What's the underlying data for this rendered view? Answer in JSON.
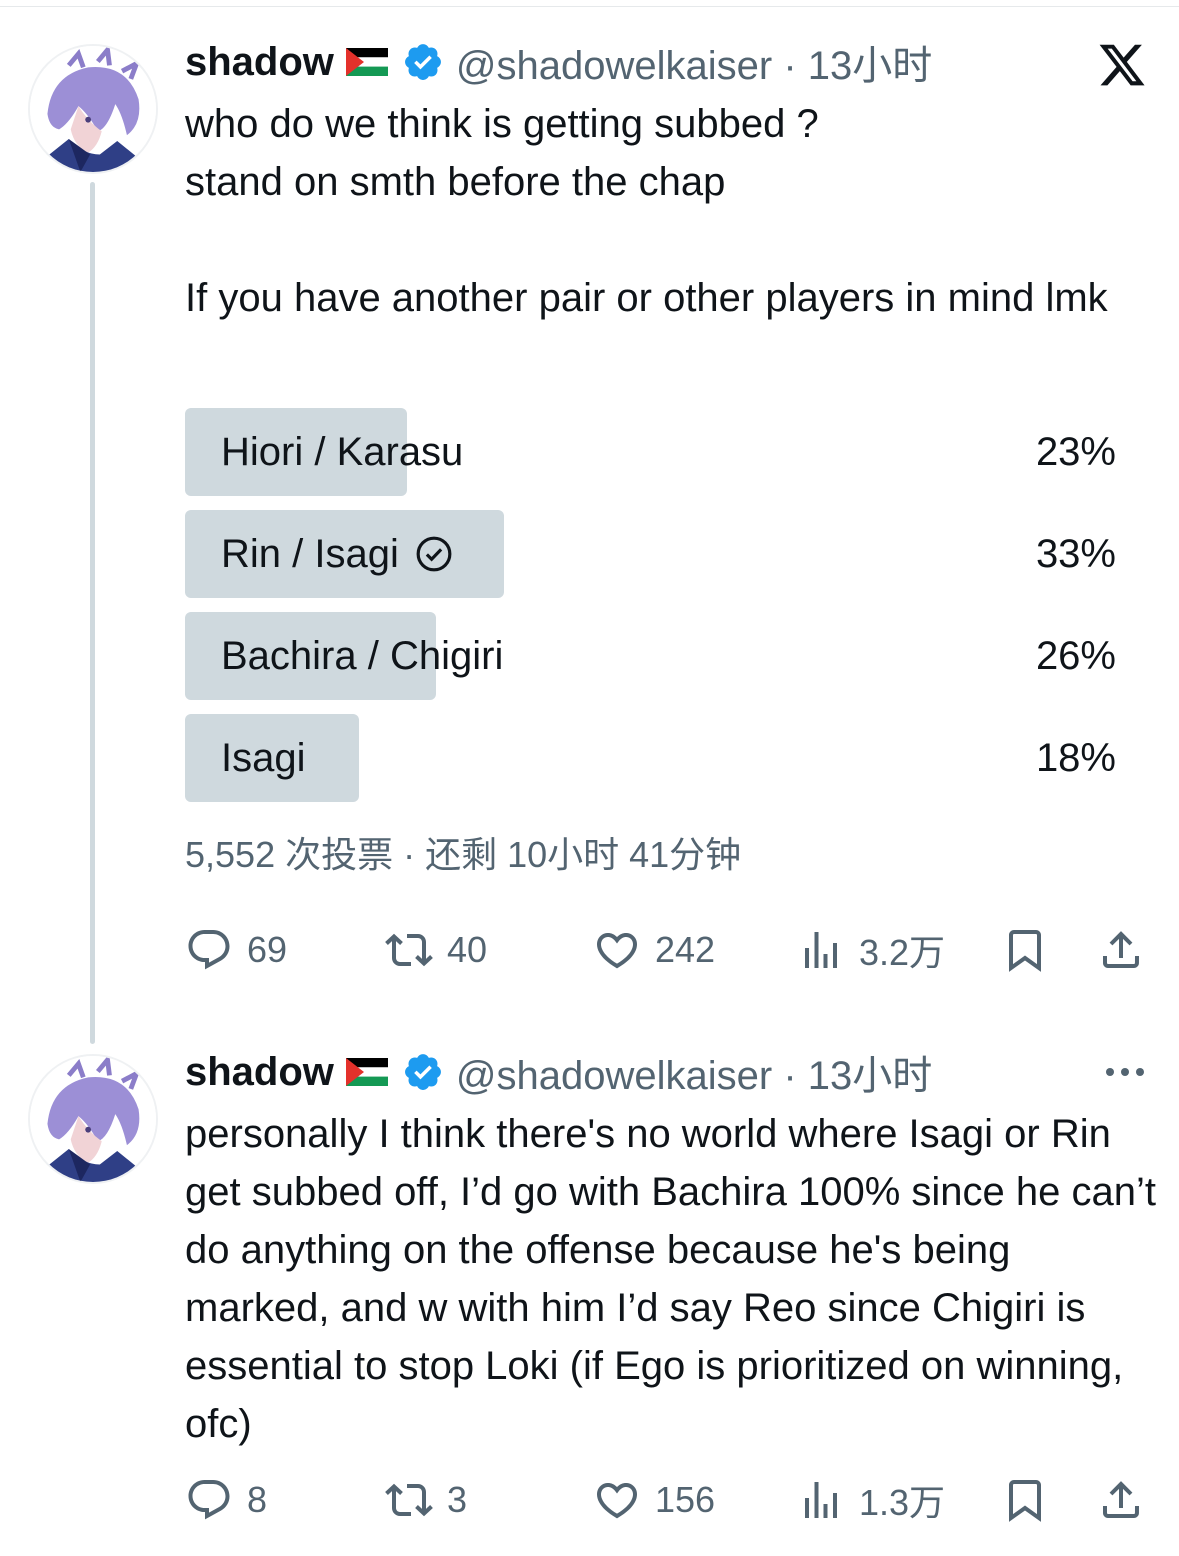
{
  "tweets": [
    {
      "display_name": "shadow",
      "handle_time": "@shadowelkaiser · 13小时",
      "text": "who do we think is getting subbed ?\nstand on smth before the chap\n\nIf you have another pair or other players in mind lmk",
      "poll": {
        "options": [
          {
            "label": "Hiori / Karasu",
            "percent_label": "23%",
            "percent": 23,
            "selected": false
          },
          {
            "label": "Rin / Isagi",
            "percent_label": "33%",
            "percent": 33,
            "selected": true
          },
          {
            "label": "Bachira / Chigiri",
            "percent_label": "26%",
            "percent": 26,
            "selected": false
          },
          {
            "label": "Isagi",
            "percent_label": "18%",
            "percent": 18,
            "selected": false
          }
        ],
        "meta": "5,552 次投票 · 还剩 10小时 41分钟"
      },
      "actions": {
        "replies": "69",
        "reposts": "40",
        "likes": "242",
        "views": "3.2万"
      }
    },
    {
      "display_name": "shadow",
      "handle_time": "@shadowelkaiser · 13小时",
      "text": "personally I think there's no world where Isagi or Rin get subbed off, I’d go with Bachira 100% since he can’t do anything on the offense because he's being marked, and w with him I’d say Reo since Chigiri is essential to stop Loki (if Ego is prioritized on winning, ofc)",
      "actions": {
        "replies": "8",
        "reposts": "3",
        "likes": "156",
        "views": "1.3万"
      }
    }
  ],
  "colors": {
    "text_primary": "#0f1419",
    "text_secondary": "#536471",
    "poll_fill": "#cfd9de",
    "verified_blue": "#1d9bf0",
    "thread_line": "#cfd9de"
  },
  "icons": {
    "brand": "x-logo-icon",
    "verified": "verified-badge-icon",
    "flag": "palestine-flag-icon",
    "reply": "reply-icon",
    "repost": "repost-icon",
    "like": "heart-icon",
    "views": "views-icon",
    "bookmark": "bookmark-icon",
    "share": "share-icon",
    "more": "more-icon",
    "selected_option": "check-circle-icon"
  }
}
